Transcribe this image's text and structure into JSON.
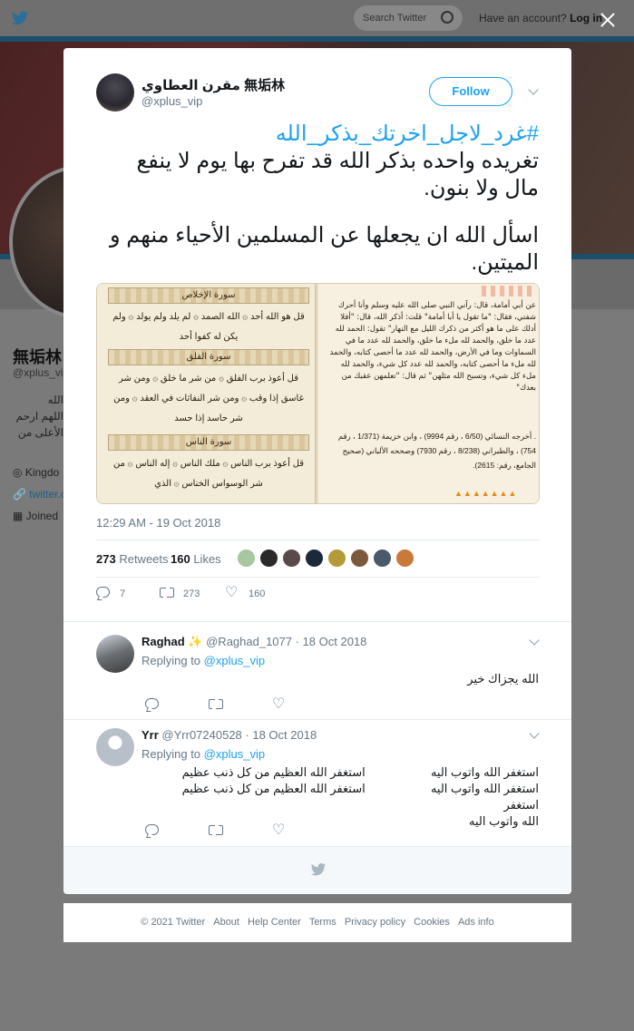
{
  "background": {
    "search_placeholder": "Search Twitter",
    "account_prompt": "Have an account?",
    "login_label": "Log in",
    "profile_name": "無垢林",
    "profile_handle": "@xplus_vi",
    "bio_lines": [
      "الله",
      "اللهم ارحم",
      "الأعلى من"
    ],
    "location": "Kingdo",
    "website": "twitter.c",
    "joined": "Joined",
    "colors": {
      "banner_rule": "#1a4f6e"
    }
  },
  "tweet": {
    "display_name": "مقرن العطاوي 無垢林",
    "handle": "@xplus_vip",
    "follow_label": "Follow",
    "hashtag": "#غرد_لاجل_اخرتك_بذكر_الله",
    "text_line1": "تغريده واحده بذكر الله قد تفرح بها يوم لا ينفع",
    "text_line2": "مال ولا بنون.",
    "text_line3": "اسأل الله ان يجعلها عن المسلمين الأحياء منهم و",
    "text_line4": "الميتين.",
    "media": {
      "right_page_text": "عن أبي أمامة، قال: رآني النبي صلى الله عليه وسلم وأنا أحرك شفتي، فقال: \"ما تقول يا أبا أمامة\" قلت: أذكر الله، قال: \"أفلا أدلك على ما هو أكثر من ذكرك الليل مع النهار\" تقول: الحمد لله عدد ما خلق، والحمد لله ملء ما خلق، والحمد لله عدد ما في السماوات وما في الأرض، والحمد لله عدد ما أحصى كتابه، والحمد لله ملء ما أحصى كتابه، والحمد لله عدد كل شيء، والحمد لله ملء كل شيء، وتسبح الله مثلهن\" ثم قال: \"تعلمهن عقبك من بعدك\"",
      "right_page_source": ". أخرجه النسائي (6/50 ، رقم 9994) ، وابن خزيمة (1/371 ، رقم 754) ، والطبراني (8/238 ، رقم 7930) وصححه الألباني (صحيح الجامع، رقم: 2615).",
      "surah_ikhlas": "سورة الإخلاص",
      "surah_falaq": "سورة الفلق",
      "surah_nas": "سورة الناس",
      "verse_ikhlas": "قل هو الله أحد ۞ الله الصمد ۞ لم يلد ولم يولد ۞ ولم يكن له كفوا أحد",
      "verse_falaq": "قل أعوذ برب الفلق ۞ من شر ما خلق ۞ ومن شر غاسق إذا وقب ۞ ومن شر النفاثات في العقد ۞ ومن شر حاسد إذا حسد",
      "verse_nas": "قل أعوذ برب الناس ۞ ملك الناس ۞ إله الناس ۞ من شر الوسواس الخناس ۞ الذي"
    },
    "timestamp": "12:29 AM - 19 Oct 2018",
    "retweets_count": "273",
    "retweets_label": "Retweets",
    "likes_count": "160",
    "likes_label": "Likes",
    "reply_count": "7",
    "retweet_action_count": "273",
    "like_action_count": "160"
  },
  "replies": [
    {
      "name": "Raghad",
      "badge": "✨",
      "handle": "@Raghad_1077",
      "date": "· 18 Oct 2018",
      "replying_label": "Replying to",
      "replying_to": "@xplus_vip",
      "text": "الله يجزاك خير"
    },
    {
      "name": "Yrr",
      "handle": "@Yrr07240528",
      "date": "· 18 Oct 2018",
      "replying_label": "Replying to",
      "replying_to": "@xplus_vip",
      "text": "استغفر الله واتوب اليه                    استغفر الله العظيم من كل ذنب عظيم\nاستغفر الله واتوب اليه                    استغفر الله العظيم من كل ذنب عظيم    استغفر\nالله واتوب اليه"
    }
  ],
  "footer": {
    "copyright": "© 2021 Twitter",
    "about": "About",
    "help": "Help Center",
    "terms": "Terms",
    "privacy": "Privacy policy",
    "cookies": "Cookies",
    "ads": "Ads info"
  },
  "icons": {
    "twitter_bird": "twitter-bird-icon",
    "search": "search-icon",
    "close": "close-icon",
    "caret": "chevron-down-icon",
    "reply": "reply-icon",
    "retweet": "retweet-icon",
    "like": "heart-icon"
  },
  "colors": {
    "accent": "#1da1f2",
    "secondary_text": "#657786",
    "border": "#e6ecf0",
    "overlay_bg": "#7a7a7a"
  }
}
